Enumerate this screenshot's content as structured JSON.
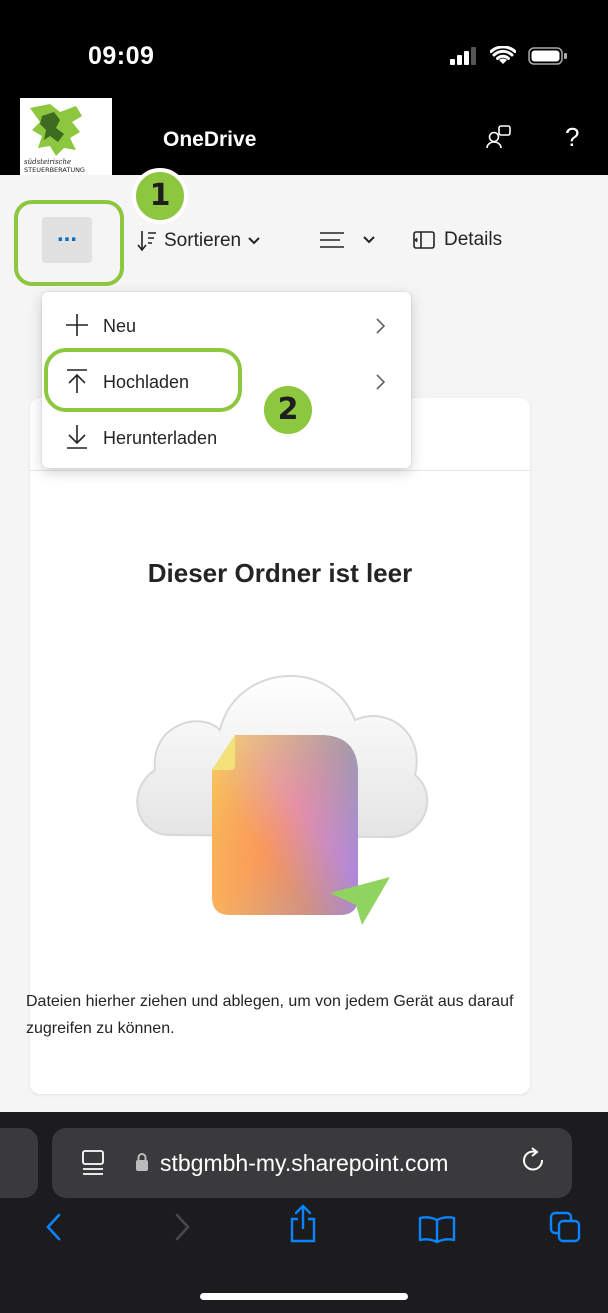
{
  "status_bar": {
    "time": "09:09"
  },
  "header": {
    "logo_text_line1": "südsteirische",
    "logo_text_line2": "STEUERBERATUNG",
    "title": "OneDrive",
    "people_icon": "people-icon",
    "help_label": "?"
  },
  "toolbar": {
    "more_label": "...",
    "sort_label": "Sortieren",
    "details_label": "Details"
  },
  "menu": {
    "items": [
      {
        "label": "Neu",
        "icon": "plus-icon",
        "has_submenu": true
      },
      {
        "label": "Hochladen",
        "icon": "upload-icon",
        "has_submenu": true
      },
      {
        "label": "Herunterladen",
        "icon": "download-icon",
        "has_submenu": false
      }
    ]
  },
  "annotations": {
    "step1": "1",
    "step2": "2",
    "ring_color": "#8dc63f"
  },
  "main": {
    "empty_title": "Dieser Ordner ist leer",
    "empty_desc": "Dateien hierher ziehen und ablegen, um von jedem Gerät aus darauf zugreifen zu können."
  },
  "browser": {
    "url": "stbgmbh-my.sharepoint.com"
  },
  "colors": {
    "accent": "#0f6cbd",
    "header_bg": "#000000",
    "annotation": "#8dc63f"
  }
}
